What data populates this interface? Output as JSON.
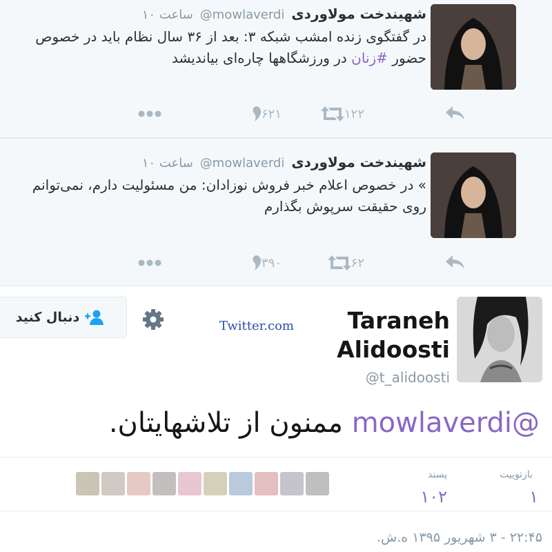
{
  "tweets": [
    {
      "name": "شهیندخت مولاوردی",
      "handle": "@mowlaverdi",
      "time": "۱۰ ساعت",
      "text_before": "در گفتگوی زنده امشب شبکه ۳: بعد از ۳۶ سال نظام باید در خصوص حضور ",
      "hashtag": "#زنان",
      "text_after": " در ورزشگاهها چاره‌ای بیاندیشد",
      "retweets": "۱۲۲",
      "likes": "۶۲۱"
    },
    {
      "name": "شهیندخت مولاوردی",
      "handle": "@mowlaverdi",
      "time": "۱۰ ساعت",
      "text_before": "» در خصوص اعلام خبر فروش نوزادان: من مسئولیت دارم، نمی‌توانم روی حقیقت سرپوش بگذارم",
      "hashtag": "",
      "text_after": "",
      "retweets": "۶۲",
      "likes": "۳۹۰"
    }
  ],
  "main_tweet": {
    "name": "Taraneh Alidoosti",
    "handle": "@t_alidoosti",
    "follow_label": "دنبال کنید",
    "watermark": "Twitter.com",
    "mention": "@mowlaverdi",
    "text": " ممنون از تلاشهایتان.",
    "retweets_label": "بازتوییت",
    "retweets_value": "۱",
    "likes_label": "پسند",
    "likes_value": "۱۰۲",
    "timestamp": "۲۲:۴۵ - ۳ شهریور ۱۳۹۵ ه.ش."
  },
  "colors": {
    "accent": "#8867c5",
    "muted": "#8899a6",
    "icon": "#aab8c2"
  },
  "icons": [
    "reply-icon",
    "retweet-icon",
    "like-icon",
    "more-icon",
    "gear-icon",
    "add-user-icon"
  ]
}
